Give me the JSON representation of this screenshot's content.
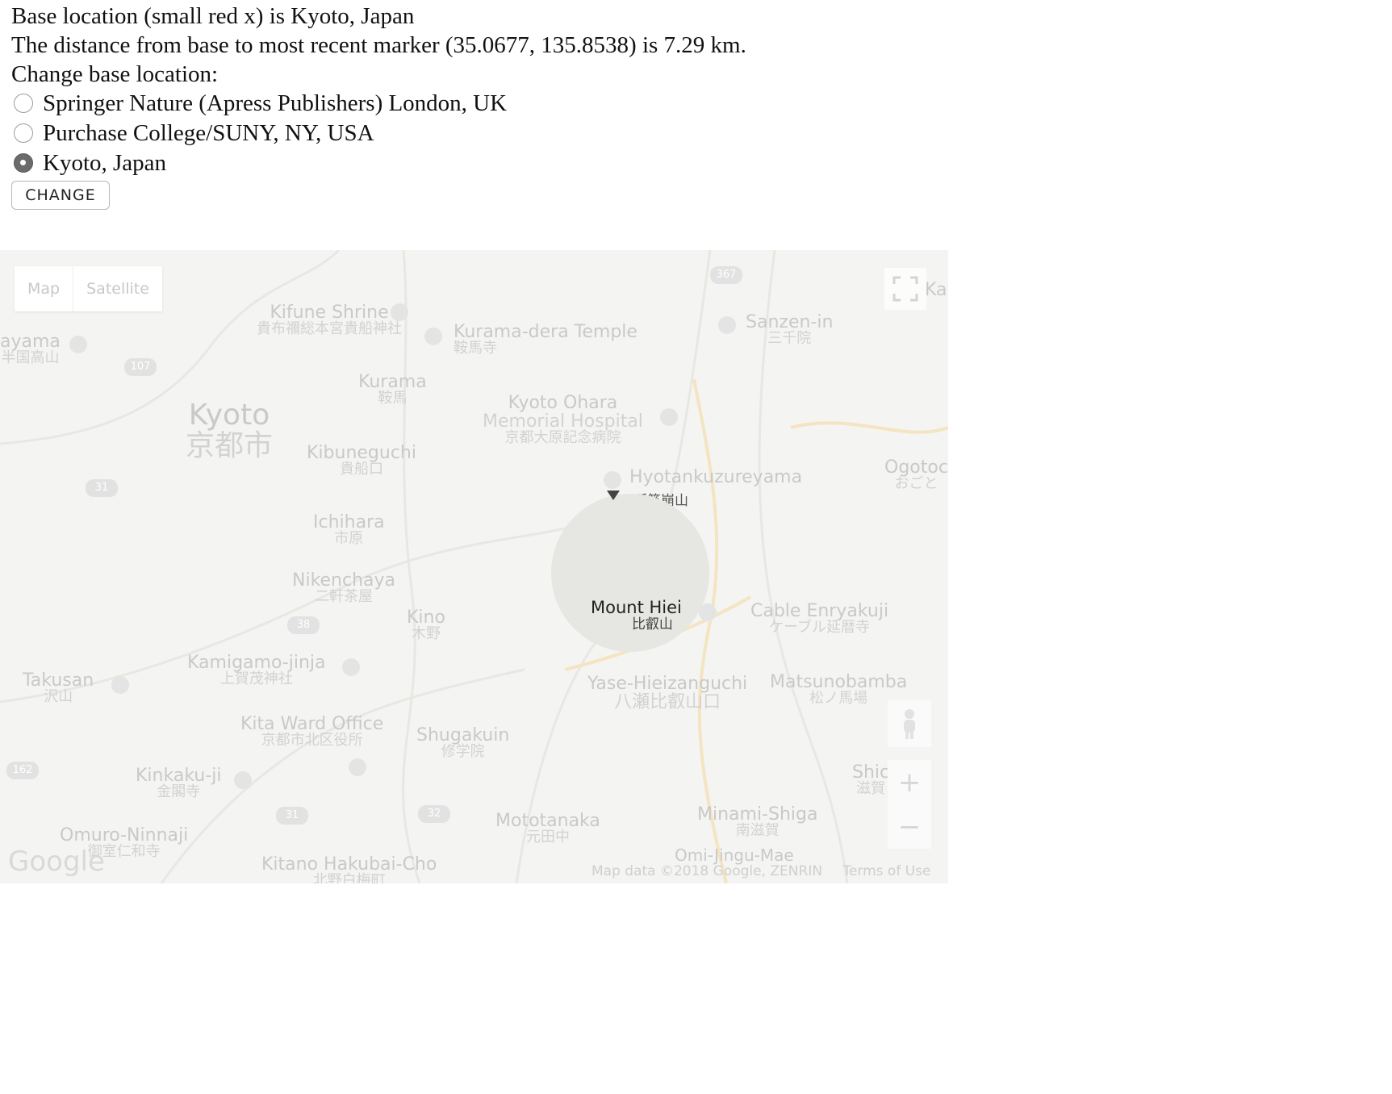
{
  "info": {
    "base_line": "Base location (small red x) is Kyoto, Japan",
    "distance_line": "The distance from base to most recent marker (35.0677, 135.8538) is 7.29 km.",
    "change_prompt": "Change base location:"
  },
  "options": [
    {
      "label": "Springer Nature (Apress Publishers) London, UK",
      "checked": false
    },
    {
      "label": "Purchase College/SUNY, NY, USA",
      "checked": false
    },
    {
      "label": "Kyoto, Japan",
      "checked": true
    }
  ],
  "change_button": "CHANGE",
  "map": {
    "type_controls": {
      "map": "Map",
      "satellite": "Satellite"
    },
    "labels": {
      "kifune": "Kifune Shrine",
      "kifune_sub": "貴布禰総本宮貴船神社",
      "kurama_dera": "Kurama-dera Temple",
      "kurama_dera_sub": "鞍馬寺",
      "sanzen": "Sanzen-in",
      "sanzen_sub": "三千院",
      "kyoto": "Kyoto",
      "kyoto_sub": "京都市",
      "kurama": "Kurama",
      "kurama_sub": "鞍馬",
      "ohara": "Kyoto Ohara",
      "ohara_2": "Memorial Hospital",
      "ohara_sub": "京都大原記念病院",
      "kibuneguchi": "Kibuneguchi",
      "kibuneguchi_sub": "貴船口",
      "hyotan": "Hyotankuzureyama",
      "hyotan_sub": "瓢箪崩山",
      "ogoto": "Ogotoc",
      "ogoto_sub": "おごと",
      "ichihara": "Ichihara",
      "ichihara_sub": "市原",
      "nikenchaya": "Nikenchaya",
      "nikenchaya_sub": "二軒茶屋",
      "kino": "Kino",
      "kino_sub": "木野",
      "hiei": "Mount Hiei",
      "hiei_sub": "比叡山",
      "cable": "Cable Enryakuji",
      "cable_sub": "ケーブル延暦寺",
      "kamigamo": "Kamigamo-jinja",
      "kamigamo_sub": "上賀茂神社",
      "yase": "Yase-Hieizanguchi",
      "yase_sub": "八瀬比叡山口",
      "matsunobamba": "Matsunobamba",
      "matsunobamba_sub": "松ノ馬場",
      "takusan": "Takusan",
      "takusan_sub": "沢山",
      "kita": "Kita Ward Office",
      "kita_sub": "京都市北区役所",
      "shugakuin": "Shugakuin",
      "shugakuin_sub": "修学院",
      "kinkaku": "Kinkaku-ji",
      "kinkaku_sub": "金閣寺",
      "shiga": "Shic",
      "shiga_sub": "滋賀",
      "mototanaka": "Mototanaka",
      "mototanaka_sub": "元田中",
      "minami": "Minami-Shiga",
      "minami_sub": "南滋賀",
      "omuro": "Omuro-Ninnaji",
      "omuro_sub": "御室仁和寺",
      "kitano": "Kitano Hakubai-Cho",
      "kitano_sub": "北野白梅町",
      "omi": "Omi-Jingu-Mae",
      "ayama": "ayama",
      "ayama_sub": "半国高山",
      "ka": "Ka"
    },
    "route_shields": [
      "367",
      "107",
      "31",
      "38",
      "162",
      "31",
      "32"
    ],
    "zoom_in": "+",
    "zoom_out": "−",
    "google_logo": "Google",
    "map_data": "Map data ©2018 Google, ZENRIN",
    "terms": "Terms of Use"
  }
}
